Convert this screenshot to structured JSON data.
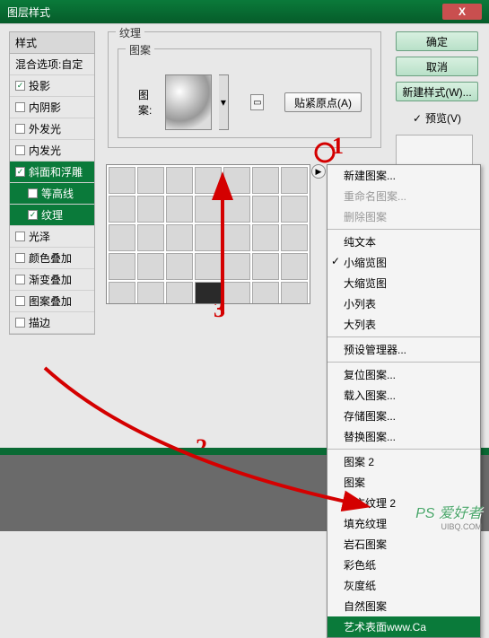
{
  "title": "图层样式",
  "sidebar": {
    "header": "样式",
    "blend": "混合选项:自定",
    "items": [
      {
        "label": "投影",
        "checked": true,
        "indent": false,
        "sel": false
      },
      {
        "label": "内阴影",
        "checked": false,
        "indent": false,
        "sel": false
      },
      {
        "label": "外发光",
        "checked": false,
        "indent": false,
        "sel": false
      },
      {
        "label": "内发光",
        "checked": false,
        "indent": false,
        "sel": false
      },
      {
        "label": "斜面和浮雕",
        "checked": true,
        "indent": false,
        "sel": true
      },
      {
        "label": "等高线",
        "checked": false,
        "indent": true,
        "sel": true
      },
      {
        "label": "纹理",
        "checked": true,
        "indent": true,
        "sel": true
      },
      {
        "label": "光泽",
        "checked": false,
        "indent": false,
        "sel": false
      },
      {
        "label": "颜色叠加",
        "checked": false,
        "indent": false,
        "sel": false
      },
      {
        "label": "渐变叠加",
        "checked": false,
        "indent": false,
        "sel": false
      },
      {
        "label": "图案叠加",
        "checked": false,
        "indent": false,
        "sel": false
      },
      {
        "label": "描边",
        "checked": false,
        "indent": false,
        "sel": false
      }
    ]
  },
  "content": {
    "group1": "纹理",
    "group2": "图案",
    "patternLabel": "图案:",
    "snap": "贴紧原点(A)"
  },
  "buttons": {
    "ok": "确定",
    "cancel": "取消",
    "newstyle": "新建样式(W)...",
    "preview": "预览(V)"
  },
  "menu": [
    {
      "label": "新建图案...",
      "type": "item"
    },
    {
      "label": "重命名图案...",
      "type": "dis"
    },
    {
      "label": "删除图案",
      "type": "dis"
    },
    {
      "type": "sep"
    },
    {
      "label": "纯文本",
      "type": "item"
    },
    {
      "label": "小缩览图",
      "type": "item",
      "checked": true
    },
    {
      "label": "大缩览图",
      "type": "item"
    },
    {
      "label": "小列表",
      "type": "item"
    },
    {
      "label": "大列表",
      "type": "item"
    },
    {
      "type": "sep"
    },
    {
      "label": "预设管理器...",
      "type": "item"
    },
    {
      "type": "sep"
    },
    {
      "label": "复位图案...",
      "type": "item"
    },
    {
      "label": "载入图案...",
      "type": "item"
    },
    {
      "label": "存储图案...",
      "type": "item"
    },
    {
      "label": "替换图案...",
      "type": "item"
    },
    {
      "type": "sep"
    },
    {
      "label": "图案 2",
      "type": "item"
    },
    {
      "label": "图案",
      "type": "item"
    },
    {
      "label": "填充纹理 2",
      "type": "item"
    },
    {
      "label": "填充纹理",
      "type": "item"
    },
    {
      "label": "岩石图案",
      "type": "item"
    },
    {
      "label": "彩色纸",
      "type": "item"
    },
    {
      "label": "灰度纸",
      "type": "item"
    },
    {
      "label": "自然图案",
      "type": "item"
    },
    {
      "label": "艺术表面www.Ca",
      "type": "sel"
    }
  ],
  "annot": {
    "a1": "1",
    "a2": "2",
    "a3": "3"
  },
  "watermark": "PS 爱好者",
  "watermark2": "UIBQ.COM"
}
